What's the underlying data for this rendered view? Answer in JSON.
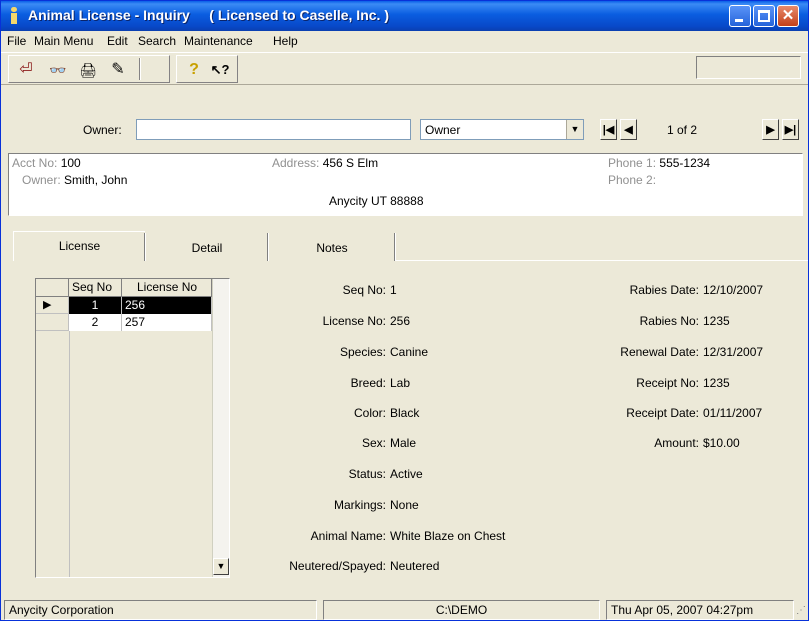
{
  "window": {
    "title": "Animal License - Inquiry     ( Licensed to Caselle, Inc. )",
    "close_glyph": "✕"
  },
  "menu": [
    "File",
    "Main Menu",
    "Edit",
    "Search",
    "Maintenance",
    "Help"
  ],
  "toolbar": {
    "icons": [
      "exit-icon",
      "binoculars-icon",
      "printer-icon",
      "notepad-icon",
      "help-icon",
      "context-help-icon"
    ],
    "glyphs": [
      "⏎",
      "👓",
      "🖨",
      "✎",
      "?",
      "↖?"
    ]
  },
  "search": {
    "owner_label": "Owner:",
    "owner_value": "",
    "sort_value": "Owner",
    "record_text": "1 of 2",
    "nav_first": "|◀",
    "nav_prev": "◀",
    "nav_next": "▶",
    "nav_last": "▶|",
    "dropdown_arrow": "▼"
  },
  "owner_info": {
    "acct_label": "Acct No:",
    "acct_value": "100",
    "owner_label": "Owner:",
    "owner_value": "Smith, John",
    "address_label": "Address:",
    "address_line1": "456 S Elm",
    "address_line2": "Anycity  UT  88888",
    "phone1_label": "Phone 1:",
    "phone1_value": "555-1234",
    "phone2_label": "Phone 2:",
    "phone2_value": ""
  },
  "tabs": [
    "License",
    "Detail",
    "Notes"
  ],
  "active_tab": "License",
  "grid": {
    "headers": [
      "Seq No",
      "License No"
    ],
    "sort_glyph": "▲",
    "rows": [
      {
        "seq": "1",
        "license": "256",
        "selected": true
      },
      {
        "seq": "2",
        "license": "257",
        "selected": false
      }
    ],
    "row_pointer": "▶",
    "scroll_down": "▼"
  },
  "license_fields": {
    "seq_no": {
      "label": "Seq No:",
      "value": "1"
    },
    "license_no": {
      "label": "License No:",
      "value": "256"
    },
    "species": {
      "label": "Species:",
      "value": "Canine"
    },
    "breed": {
      "label": "Breed:",
      "value": "Lab"
    },
    "color": {
      "label": "Color:",
      "value": "Black"
    },
    "sex": {
      "label": "Sex:",
      "value": "Male"
    },
    "status": {
      "label": "Status:",
      "value": "Active"
    },
    "markings": {
      "label": "Markings:",
      "value": "None"
    },
    "animal_name": {
      "label": "Animal Name:",
      "value": "White Blaze on Chest"
    },
    "neutered": {
      "label": "Neutered/Spayed:",
      "value": "Neutered"
    }
  },
  "rabies_fields": {
    "rabies_date": {
      "label": "Rabies Date:",
      "value": "12/10/2007"
    },
    "rabies_no": {
      "label": "Rabies No:",
      "value": "1235"
    },
    "renewal_date": {
      "label": "Renewal Date:",
      "value": "12/31/2007"
    },
    "receipt_no": {
      "label": "Receipt No:",
      "value": "1235"
    },
    "receipt_date": {
      "label": "Receipt Date:",
      "value": "01/11/2007"
    },
    "amount": {
      "label": "Amount:",
      "value": "$10.00"
    }
  },
  "status_bar": {
    "company": "Anycity Corporation",
    "path": "C:\\DEMO",
    "datetime": "Thu Apr 05, 2007  04:27pm"
  }
}
